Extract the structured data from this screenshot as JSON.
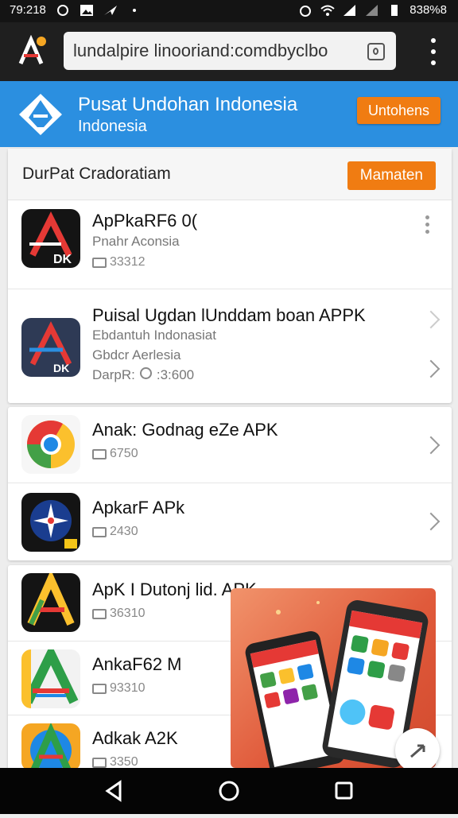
{
  "status": {
    "time": "79:218",
    "battery": "838%8"
  },
  "browser": {
    "url": "lundalpire linooriand:comdbyclbo"
  },
  "site": {
    "title": "Pusat Undohan Indonesia",
    "subtitle": "Indonesia",
    "header_button": "Untohens"
  },
  "section": {
    "title": "DurPat Cradoratiam",
    "button": "Mamaten"
  },
  "apps": [
    {
      "name": "ApPkaRF6 0(",
      "sub": "Pnahr Aconsia",
      "count": "33312",
      "icon": "ak-dk-logo-icon"
    },
    {
      "name": "Puisal Ugdan lUnddam boan APPK",
      "line1": "Ebdantuh Indonasiat",
      "line2": "Gbdcr Aerlesia",
      "line3_label": "DarpR:",
      "line3_value": ":3:600",
      "icon": "ak-dk-blue-logo-icon"
    },
    {
      "name": "Anak: Godnag eZe APK",
      "count": "6750",
      "icon": "chrome-logo-icon"
    },
    {
      "name": "ApkarF APk",
      "count": "2430",
      "icon": "compass-star-icon"
    },
    {
      "name": "ApK I Dutonj lid. APK",
      "count": "36310",
      "icon": "colorful-a-logo-icon"
    },
    {
      "name": "AnkaF62 M",
      "count": "93310",
      "icon": "green-a-logo-icon"
    },
    {
      "name": "Adkak A2K",
      "count": "3350",
      "icon": "multicolor-a-logo-icon"
    }
  ],
  "colors": {
    "header_blue": "#2b8fe0",
    "accent_orange": "#f07c12"
  }
}
